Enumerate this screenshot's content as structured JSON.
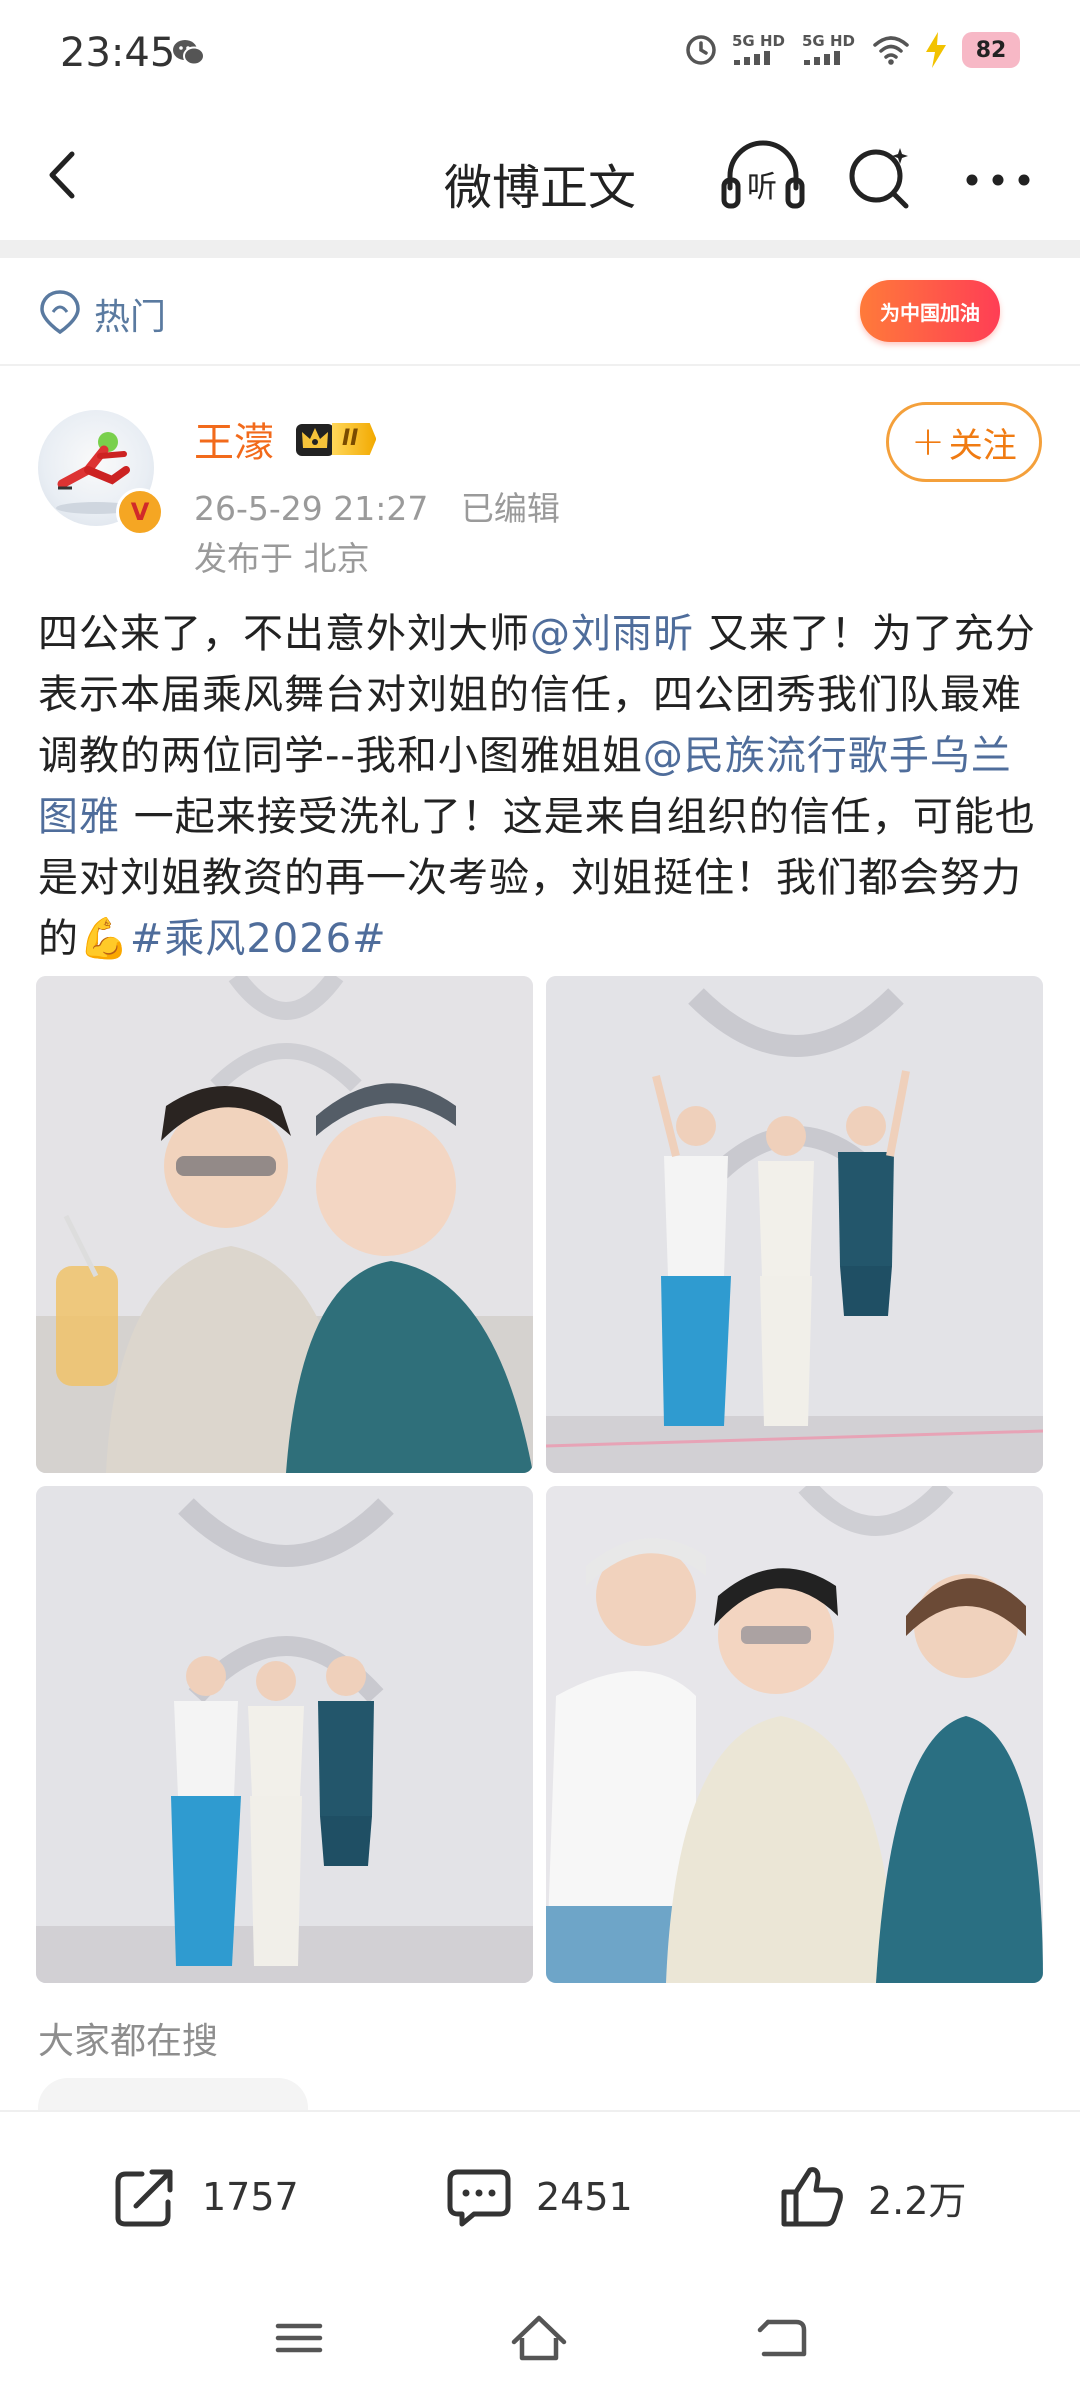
{
  "status_bar": {
    "time": "23:45",
    "network_1": "5G HD",
    "network_2": "5G HD",
    "battery_level": "82",
    "icons": [
      "wechat-icon",
      "alarm-icon",
      "signal-icon",
      "wifi-icon",
      "charging-icon",
      "battery-icon"
    ]
  },
  "nav": {
    "title": "微博正文",
    "listen_label": "听",
    "icons": [
      "back-icon",
      "listen-icon",
      "search-icon",
      "more-icon"
    ]
  },
  "hot": {
    "label": "热门",
    "promo_text": "为中国加油"
  },
  "post": {
    "username": "王濛",
    "vip_level": "II",
    "timestamp": "26-5-29 21:27",
    "edited_label": "已编辑",
    "location": "发布于 北京",
    "follow_label": "关注",
    "follow_plus": "+",
    "text": {
      "p1": "四公来了，不出意外刘大师",
      "mention1": "@刘雨昕",
      "p2": " 又来了！为了充分表示本届乘风舞台对刘姐的信任，四公团秀我们队最难调教的两位同学--我和小图雅姐姐",
      "mention2": "@民族流行歌手乌兰图雅",
      "p3": " 一起来接受洗礼了！这是来自组织的信任，可能也是对刘姐教资的再一次考验，刘姐挺住！我们都会努力的",
      "emoji": "💪",
      "topic": "#乘风2026#"
    },
    "photos": [
      "photo-1",
      "photo-2",
      "photo-3",
      "photo-4"
    ]
  },
  "search": {
    "section_title": "大家都在搜"
  },
  "actions": {
    "repost_count": "1757",
    "comment_count": "2451",
    "like_count": "2.2万"
  },
  "colors": {
    "username": "#f26a1b",
    "mention": "#4f6d9b",
    "follow": "#f07b12"
  }
}
